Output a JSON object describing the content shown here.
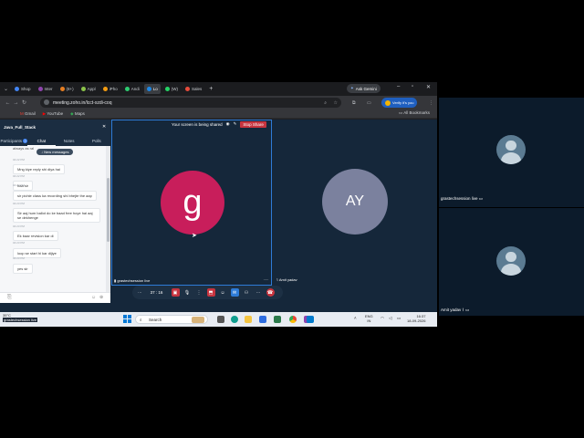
{
  "browser": {
    "tabs": [
      {
        "label": "Shop",
        "color": "#4285f4"
      },
      {
        "label": "Inter",
        "color": "#8e44ad"
      },
      {
        "label": "(8+)",
        "color": "#e67e22"
      },
      {
        "label": "Appl",
        "color": "#8bc34a"
      },
      {
        "label": "iPho",
        "color": "#f39c12"
      },
      {
        "label": "Andi",
        "color": "#2ecc71"
      },
      {
        "label": "Lo",
        "color": "#1e88e5"
      },
      {
        "label": "(W)",
        "color": "#25d366"
      },
      {
        "label": "Sales",
        "color": "#e74c3c"
      }
    ],
    "gemini_label": "Ask Gemini",
    "url": "meeting.zoho.in/lcct-xzdi-coq",
    "verify_label": "Verify it's you",
    "bookmarks": [
      "Gmail",
      "YouTube",
      "Maps"
    ],
    "all_bookmarks": "All Bookmarks"
  },
  "panel": {
    "title": "Java_Full_Stack",
    "tabs": [
      "Participants",
      "Chat",
      "Notes",
      "Polls"
    ],
    "participants_count": "3",
    "messages": [
      {
        "time": "04:22 PM",
        "text": "Mng kiye reply shi diya hai"
      },
      {
        "time": "04:22 PM",
        "text": "haa sir"
      },
      {
        "time": "04:23 PM",
        "text": "sir pichle class ka recording shi bhejte the aap"
      },
      {
        "time": "04:23 PM",
        "text": "Sir aaj hum ballot do ke baad free hoye hai aaj se dekhenge"
      },
      {
        "time": "04:23 PM",
        "text": "Ek baar revision kar di"
      },
      {
        "time": "04:23 PM",
        "text": "loop se start  hi kar dijiye"
      },
      {
        "time": "04:23 PM",
        "text": "yes sir"
      }
    ],
    "first_line": "always as ral",
    "new_messages": "New messages"
  },
  "meeting": {
    "sharing_text": "Your screen is being shared",
    "stop_share": "Stop Share",
    "tile1_initial": "g",
    "tile1_name": "grastechsession live",
    "tile2_initial": "AY",
    "tile2_name": "Amit yadav",
    "counter": "37 : 16"
  },
  "taskbar": {
    "search_placeholder": "Search",
    "weather": "35°C",
    "weather_sub": "grastechsession live",
    "lang": "ENG",
    "lang_sub": "IN",
    "time": "16:37",
    "date": "18-09-2026"
  },
  "right_panel": {
    "tile1_name": "grastechsession live",
    "tile2_name": "Amit yadav"
  },
  "colors": {
    "avatar_g": "#c81e5b",
    "avatar_ay": "#7b819e",
    "accent_blue": "#2e7bd6",
    "stop_red": "#c7343f"
  }
}
